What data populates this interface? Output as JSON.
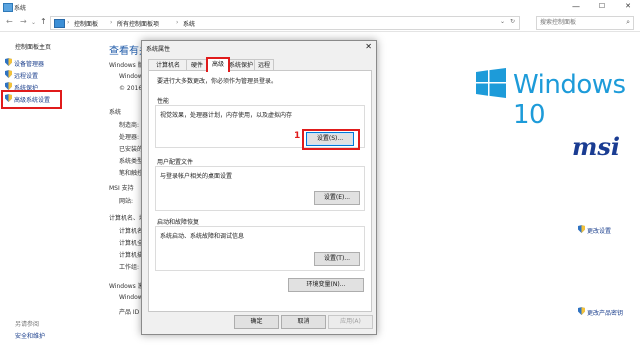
{
  "window": {
    "title": "系统",
    "controls": {
      "minimize": "—",
      "maximize": "☐",
      "close": "✕"
    }
  },
  "address": {
    "back": "←",
    "forward": "→",
    "up": "↑",
    "crumbs": [
      "控制面板",
      "所有控制面板项",
      "系统"
    ],
    "separator": "›",
    "search_placeholder": "搜索控制面板"
  },
  "sidebar": {
    "home": "控制面板主页",
    "items": [
      {
        "label": "设备管理器"
      },
      {
        "label": "远程设置"
      },
      {
        "label": "系统保护"
      },
      {
        "label": "高级系统设置"
      }
    ],
    "see_also_title": "另请参阅",
    "see_also": [
      "安全和维护"
    ]
  },
  "main": {
    "header": "查看有关",
    "edition_section": "Windows 版",
    "edition_lines": [
      "Window",
      "© 2016"
    ],
    "system_section": "系统",
    "system_labels": [
      "制造商:",
      "处理器:",
      "已安装的",
      "系统类型",
      "笔和触控"
    ],
    "support_section": "MSI 支持",
    "support_labels": [
      "网站:"
    ],
    "computer_section": "计算机名、域和",
    "computer_labels": [
      "计算机名",
      "计算机全",
      "计算机描",
      "工作组:"
    ],
    "change_settings": "更改设置",
    "activation_section": "Windows 激",
    "activation_labels": [
      "Window",
      "产品 ID"
    ],
    "change_key": "更改产品密钥",
    "brand_windows": "Windows 10",
    "brand_msi": "msi"
  },
  "dialog": {
    "title": "系统属性",
    "close": "✕",
    "tabs": [
      "计算机名",
      "硬件",
      "高级",
      "系统保护",
      "远程"
    ],
    "active_tab": "高级",
    "note": "要进行大多数更改，你必须作为管理员登录。",
    "performance": {
      "title": "性能",
      "desc": "视觉效果，处理器计划，内存使用，以及虚拟内存",
      "button": "设置(S)..."
    },
    "profiles": {
      "title": "用户配置文件",
      "desc": "与登录帐户相关的桌面设置",
      "button": "设置(E)..."
    },
    "startup": {
      "title": "启动和故障恢复",
      "desc": "系统启动、系统故障和调试信息",
      "button": "设置(T)..."
    },
    "env_button": "环境变量(N)...",
    "ok": "确定",
    "cancel": "取消",
    "apply": "应用(A)"
  },
  "annotation": {
    "step": "1"
  },
  "colors": {
    "accent": "#1d9bd9",
    "highlight_red": "#e01b1b",
    "link": "#1a3e8c",
    "msi_blue": "#1a3c92"
  }
}
